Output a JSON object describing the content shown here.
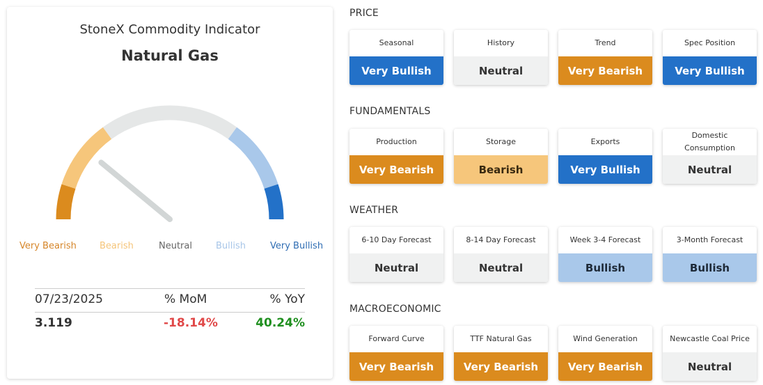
{
  "header": {
    "brand": "StoneX Commodity Indicator",
    "commodity": "Natural Gas"
  },
  "gauge": {
    "level_fraction": 0.22,
    "labels": [
      {
        "text": "Very Bearish",
        "color": "#d6862a"
      },
      {
        "text": "Bearish",
        "color": "#f5c57a"
      },
      {
        "text": "Neutral",
        "color": "#666666"
      },
      {
        "text": "Bullish",
        "color": "#a8c6e8"
      },
      {
        "text": "Very Bullish",
        "color": "#2f6db3"
      }
    ]
  },
  "stats": {
    "date": "07/23/2025",
    "mom_label": "% MoM",
    "yoy_label": "% YoY",
    "price": "3.119",
    "mom_value": "-18.14%",
    "yoy_value": "40.24%",
    "mom_color": "#e04848",
    "yoy_color": "#1f8f1f"
  },
  "signal_styles": {
    "Very Bullish": {
      "bg": "#2371c8",
      "fg": "#ffffff"
    },
    "Bullish": {
      "bg": "#a9c8ea",
      "fg": "#1e2a38"
    },
    "Neutral": {
      "bg": "#f0f1f1",
      "fg": "#333333"
    },
    "Bearish": {
      "bg": "#f6c67b",
      "fg": "#3a2a10"
    },
    "Very Bearish": {
      "bg": "#db8b1e",
      "fg": "#ffffff"
    }
  },
  "sections": [
    {
      "title": "PRICE",
      "items": [
        {
          "name": "Seasonal",
          "signal": "Very Bullish"
        },
        {
          "name": "History",
          "signal": "Neutral"
        },
        {
          "name": "Trend",
          "signal": "Very Bearish"
        },
        {
          "name": "Spec Position",
          "signal": "Very Bullish"
        }
      ]
    },
    {
      "title": "FUNDAMENTALS",
      "items": [
        {
          "name": "Production",
          "signal": "Very Bearish"
        },
        {
          "name": "Storage",
          "signal": "Bearish"
        },
        {
          "name": "Exports",
          "signal": "Very Bullish"
        },
        {
          "name": "Domestic Consumption",
          "signal": "Neutral"
        }
      ]
    },
    {
      "title": "WEATHER",
      "items": [
        {
          "name": "6-10 Day Forecast",
          "signal": "Neutral"
        },
        {
          "name": "8-14 Day Forecast",
          "signal": "Neutral"
        },
        {
          "name": "Week 3-4 Forecast",
          "signal": "Bullish"
        },
        {
          "name": "3-Month Forecast",
          "signal": "Bullish"
        }
      ]
    },
    {
      "title": "MACROECONOMIC",
      "items": [
        {
          "name": "Forward Curve",
          "signal": "Very Bearish"
        },
        {
          "name": "TTF Natural Gas",
          "signal": "Very Bearish"
        },
        {
          "name": "Wind Generation",
          "signal": "Very Bearish"
        },
        {
          "name": "Newcastle Coal Price",
          "signal": "Neutral"
        }
      ]
    }
  ]
}
